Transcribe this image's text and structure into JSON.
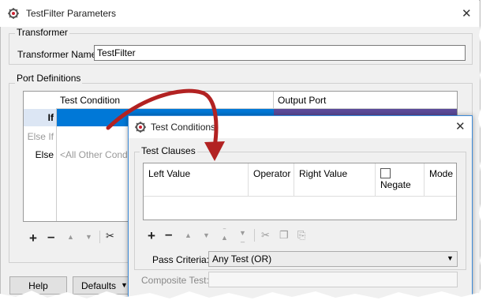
{
  "main_dialog": {
    "title": "TestFilter Parameters",
    "transformer_group_label": "Transformer",
    "transformer_name_label": "Transformer Name:",
    "transformer_name_value": "TestFilter",
    "port_definitions_label": "Port Definitions",
    "port_table": {
      "columns": [
        "Test Condition",
        "Output Port"
      ],
      "rows": [
        {
          "label": "If",
          "condition": "",
          "selected": true
        },
        {
          "label": "Else If",
          "condition": "",
          "disabled": true
        },
        {
          "label": "Else",
          "condition": "<All Other Cond"
        }
      ]
    },
    "toolbar_icons": [
      "add-icon",
      "remove-icon",
      "move-up-icon",
      "move-down-icon",
      "cut-icon"
    ],
    "buttons": {
      "help": "Help",
      "defaults": "Defaults"
    }
  },
  "sub_dialog": {
    "title": "Test Conditions",
    "test_clauses_label": "Test Clauses",
    "table_columns": {
      "left_value": "Left Value",
      "operator": "Operator",
      "right_value": "Right Value",
      "negate": "Negate",
      "mode": "Mode"
    },
    "toolbar_icons": [
      "add-icon",
      "remove-icon",
      "move-up-icon",
      "move-down-icon",
      "move-top-icon",
      "move-bottom-icon",
      "cut-icon",
      "copy-icon",
      "paste-icon"
    ],
    "pass_criteria_label": "Pass Criteria:",
    "pass_criteria_value": "Any Test (OR)",
    "composite_test_label": "Composite Test:"
  },
  "colors": {
    "selection_blue": "#0078d7",
    "output_port_purple": "#5b4a99",
    "annotation_arrow": "#b22222"
  }
}
